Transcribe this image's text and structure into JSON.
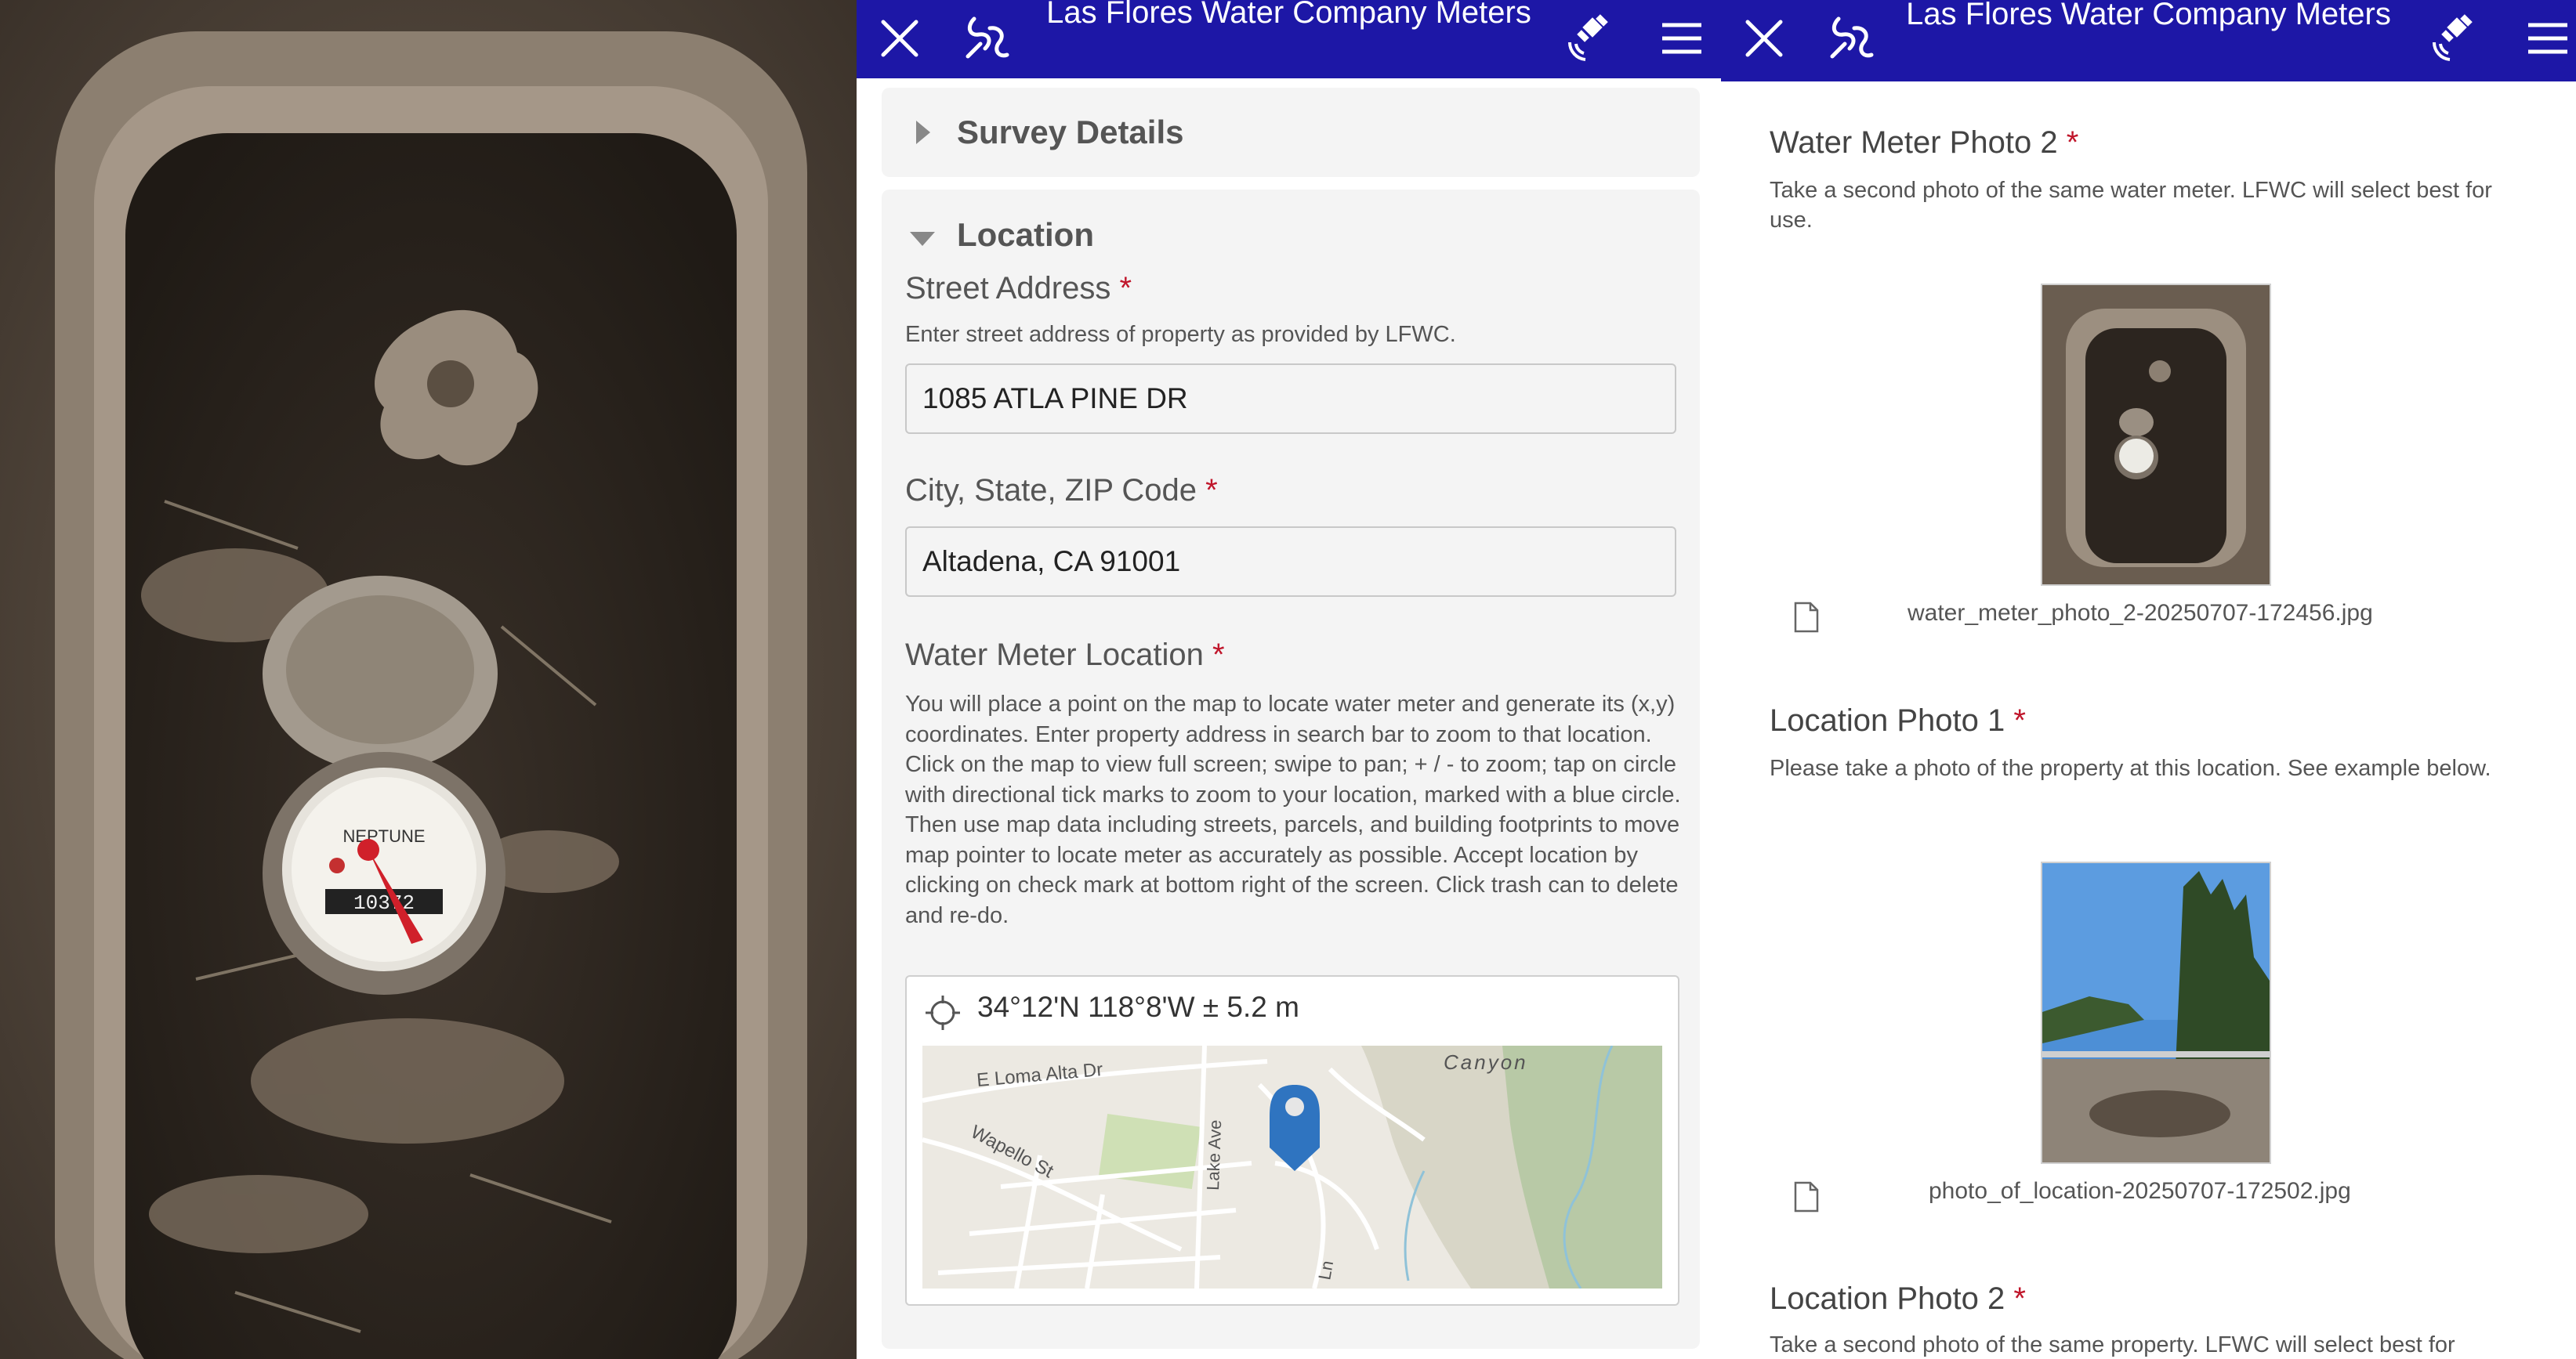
{
  "app": {
    "title": "Las Flores Water Company Meters",
    "header_color": "#1d17a6",
    "required_color": "#c0162b",
    "icons": [
      "close-icon",
      "collect-icon",
      "gps-satellite-icon",
      "menu-icon"
    ]
  },
  "photo_panel": {
    "meter_brand": "NEPTUNE",
    "meter_reading": "10372"
  },
  "form": {
    "survey_details": {
      "title": "Survey Details",
      "expanded": false
    },
    "location": {
      "title": "Location",
      "expanded": true,
      "street_address": {
        "label": "Street Address",
        "required": "*",
        "hint": "Enter street address of property as provided by LFWC.",
        "value": "1085 ATLA PINE DR"
      },
      "city_state_zip": {
        "label": "City, State, ZIP Code",
        "required": "*",
        "value": "Altadena, CA 91001"
      },
      "meter_location": {
        "label": "Water Meter Location",
        "required": "*",
        "hint": "You will place a point on the map to locate water meter and generate its (x,y) coordinates. Enter property address in search bar to zoom to that location. Click on the map to view full screen; swipe to pan; + / - to zoom; tap on circle with directional tick marks to zoom to your location, marked with a blue circle. Then use map data including streets, parcels, and building footprints to move map pointer to locate meter as accurately as possible. Accept location by clicking on check mark at bottom right of the screen. Click trash can to delete and re-do.",
        "coordinates": "34°12'N 118°8'W ± 5.2 m",
        "map_labels": {
          "street1": "E Loma Alta Dr",
          "street2": "Wapello St",
          "street3": "Lake Ave",
          "area": "Canyon",
          "lane": "Ln"
        }
      }
    }
  },
  "gallery": {
    "water_meter_photo_2": {
      "label": "Water Meter Photo 2",
      "required": "*",
      "hint": "Take a second photo of the same water meter. LFWC will select best for use.",
      "filename": "water_meter_photo_2-20250707-172456.jpg"
    },
    "location_photo_1": {
      "label": "Location Photo 1",
      "required": "*",
      "hint": "Please take a photo of the property at this location. See example below.",
      "filename": "photo_of_location-20250707-172502.jpg"
    },
    "location_photo_2": {
      "label": "Location Photo 2",
      "required": "*",
      "hint": "Take a second photo of the same property. LFWC will select best for"
    }
  }
}
